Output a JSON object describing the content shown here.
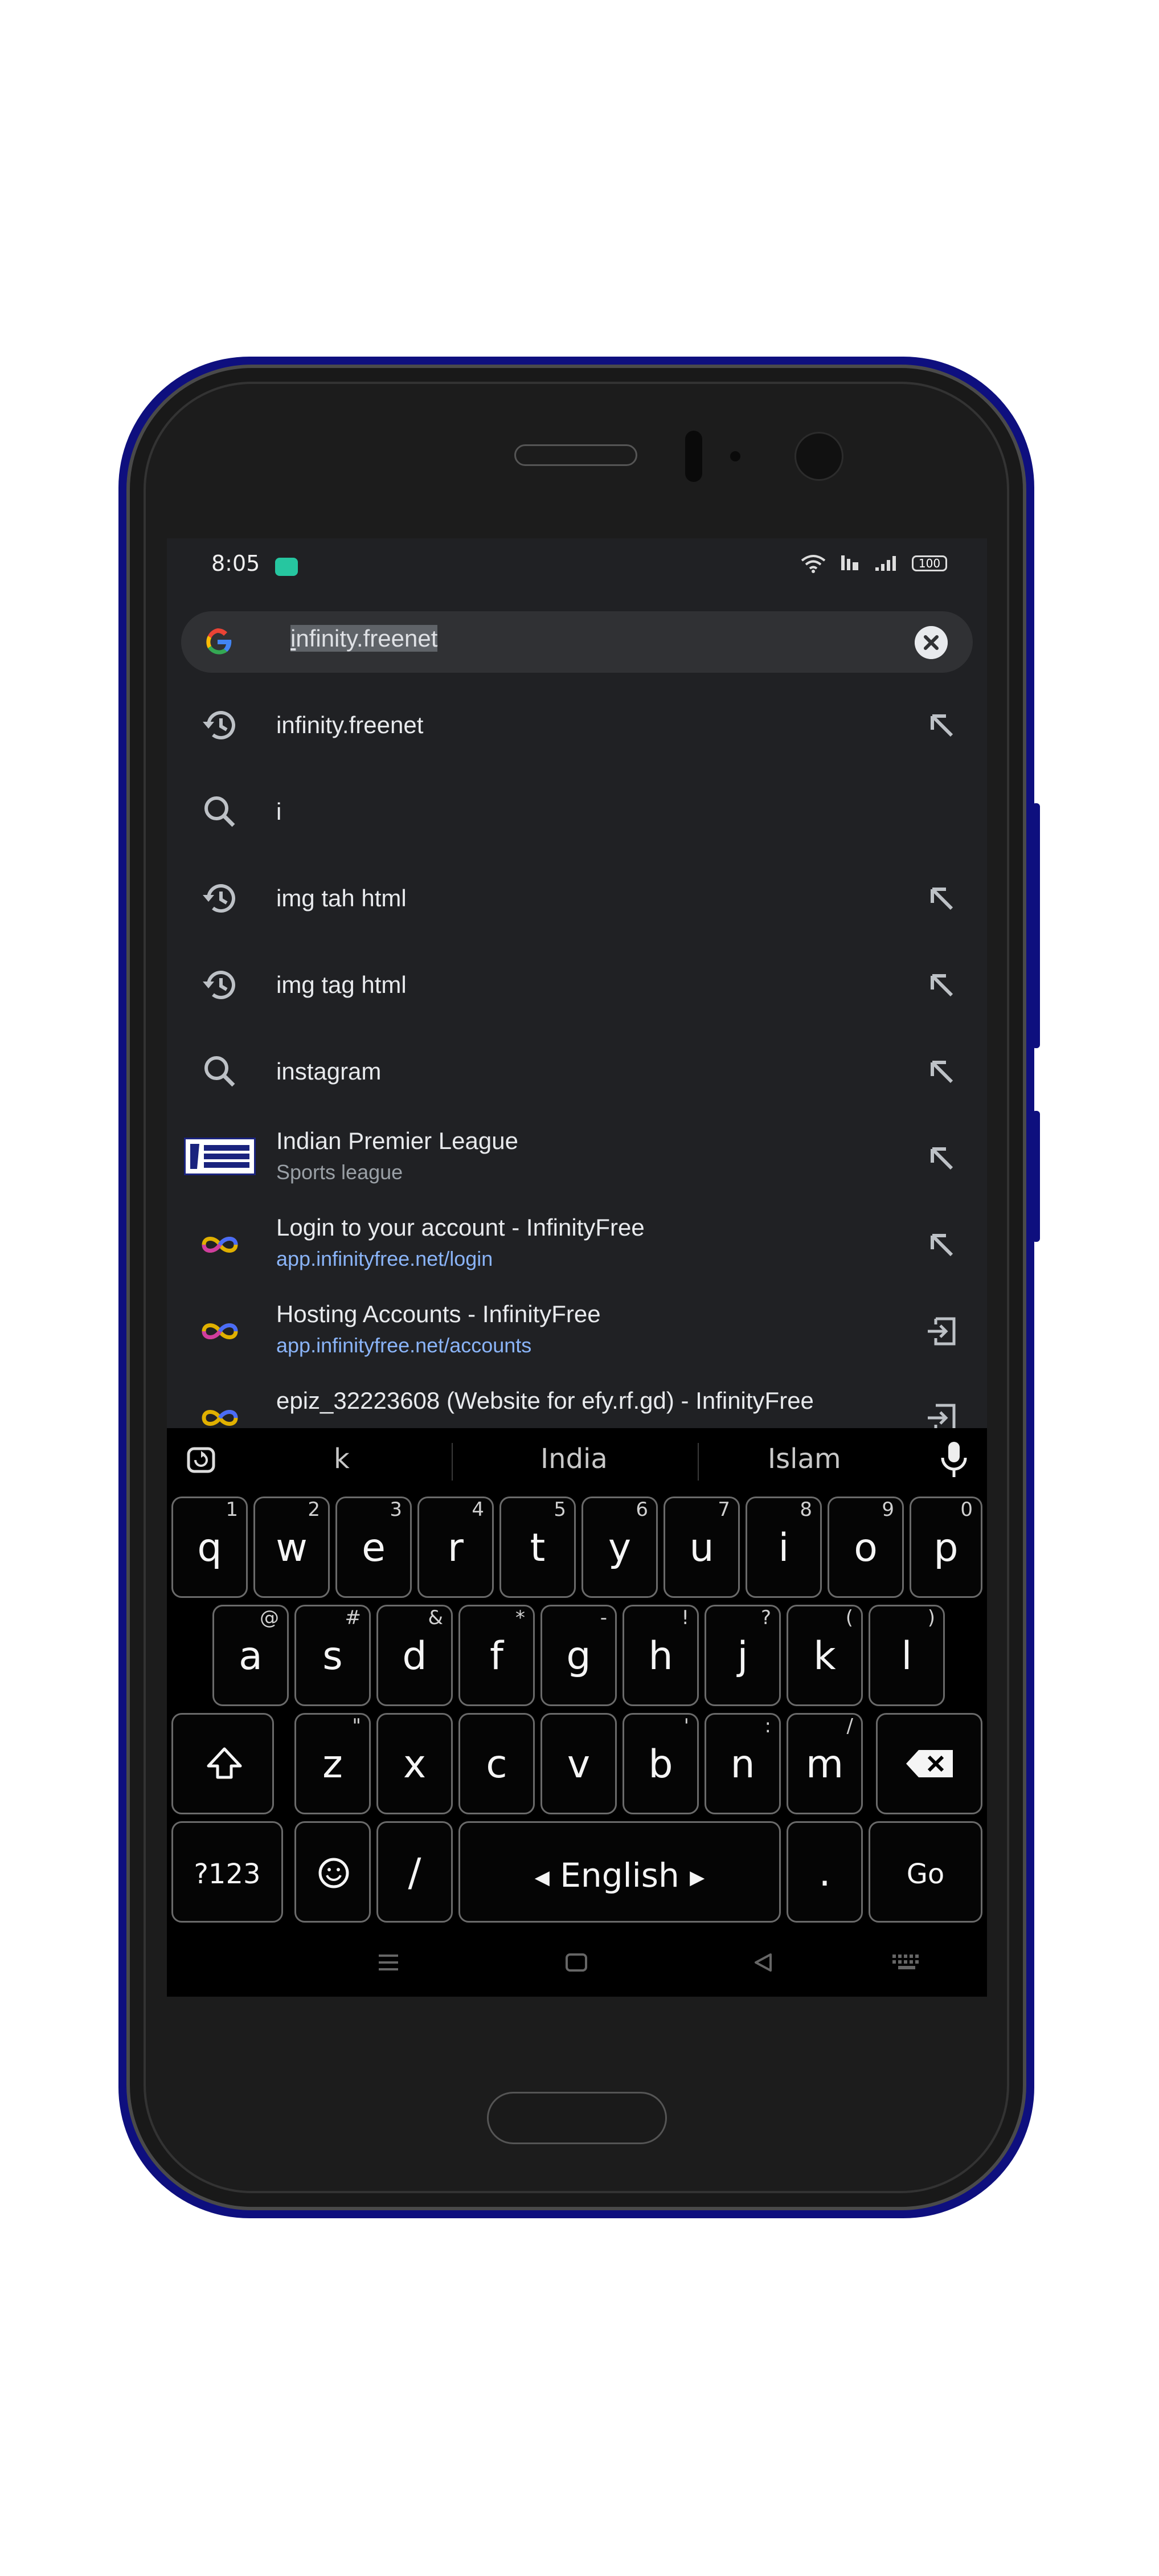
{
  "status_bar": {
    "time": "8:05",
    "battery": "100"
  },
  "search": {
    "query": "infinity.freenet",
    "highlight_prefix": "i",
    "highlight_rest": "nfinity.freenet"
  },
  "suggestions": [
    {
      "type": "history",
      "title": "infinity.freenet",
      "action": "fill"
    },
    {
      "type": "search",
      "title": "i",
      "action": "none"
    },
    {
      "type": "history",
      "title": "img tah html",
      "action": "fill"
    },
    {
      "type": "history",
      "title": "img tag html",
      "action": "fill"
    },
    {
      "type": "search",
      "title": "instagram",
      "action": "fill"
    },
    {
      "type": "entity",
      "title": "Indian Premier League",
      "subtitle": "Sports league",
      "action": "fill",
      "logo_text": "INDIAN PREMIER LEAGUE"
    },
    {
      "type": "site",
      "title": "Login to your account - InfinityFree",
      "subtitle": "app.infinityfree.net/login",
      "action": "fill"
    },
    {
      "type": "site",
      "title": "Hosting Accounts - InfinityFree",
      "subtitle": "app.infinityfree.net/accounts",
      "action": "open"
    },
    {
      "type": "site",
      "title": "epiz_32223608 (Website for efy.rf.gd) - InfinityFree",
      "subtitle": "",
      "action": "open"
    }
  ],
  "keyboard": {
    "suggestions": [
      "k",
      "India",
      "Islam"
    ],
    "row1": [
      {
        "key": "q",
        "hint": "1"
      },
      {
        "key": "w",
        "hint": "2"
      },
      {
        "key": "e",
        "hint": "3"
      },
      {
        "key": "r",
        "hint": "4"
      },
      {
        "key": "t",
        "hint": "5"
      },
      {
        "key": "y",
        "hint": "6"
      },
      {
        "key": "u",
        "hint": "7"
      },
      {
        "key": "i",
        "hint": "8"
      },
      {
        "key": "o",
        "hint": "9"
      },
      {
        "key": "p",
        "hint": "0"
      }
    ],
    "row2": [
      {
        "key": "a",
        "hint": "@"
      },
      {
        "key": "s",
        "hint": "#"
      },
      {
        "key": "d",
        "hint": "&"
      },
      {
        "key": "f",
        "hint": "*"
      },
      {
        "key": "g",
        "hint": "-"
      },
      {
        "key": "h",
        "hint": "!"
      },
      {
        "key": "j",
        "hint": "?"
      },
      {
        "key": "k",
        "hint": "("
      },
      {
        "key": "l",
        "hint": ")"
      }
    ],
    "row3": [
      {
        "key": "z",
        "hint": "\""
      },
      {
        "key": "x",
        "hint": ""
      },
      {
        "key": "c",
        "hint": ""
      },
      {
        "key": "v",
        "hint": ""
      },
      {
        "key": "b",
        "hint": "'"
      },
      {
        "key": "n",
        "hint": ":"
      },
      {
        "key": "m",
        "hint": "/"
      }
    ],
    "symbols_label": "?123",
    "slash_label": "/",
    "space_label": "English",
    "period_label": ".",
    "go_label": "Go"
  },
  "colors": {
    "screen_bg": "#202124",
    "search_bar_bg": "#303134",
    "link": "#8ab4f8",
    "phone_frame": "#0e0f7e"
  }
}
